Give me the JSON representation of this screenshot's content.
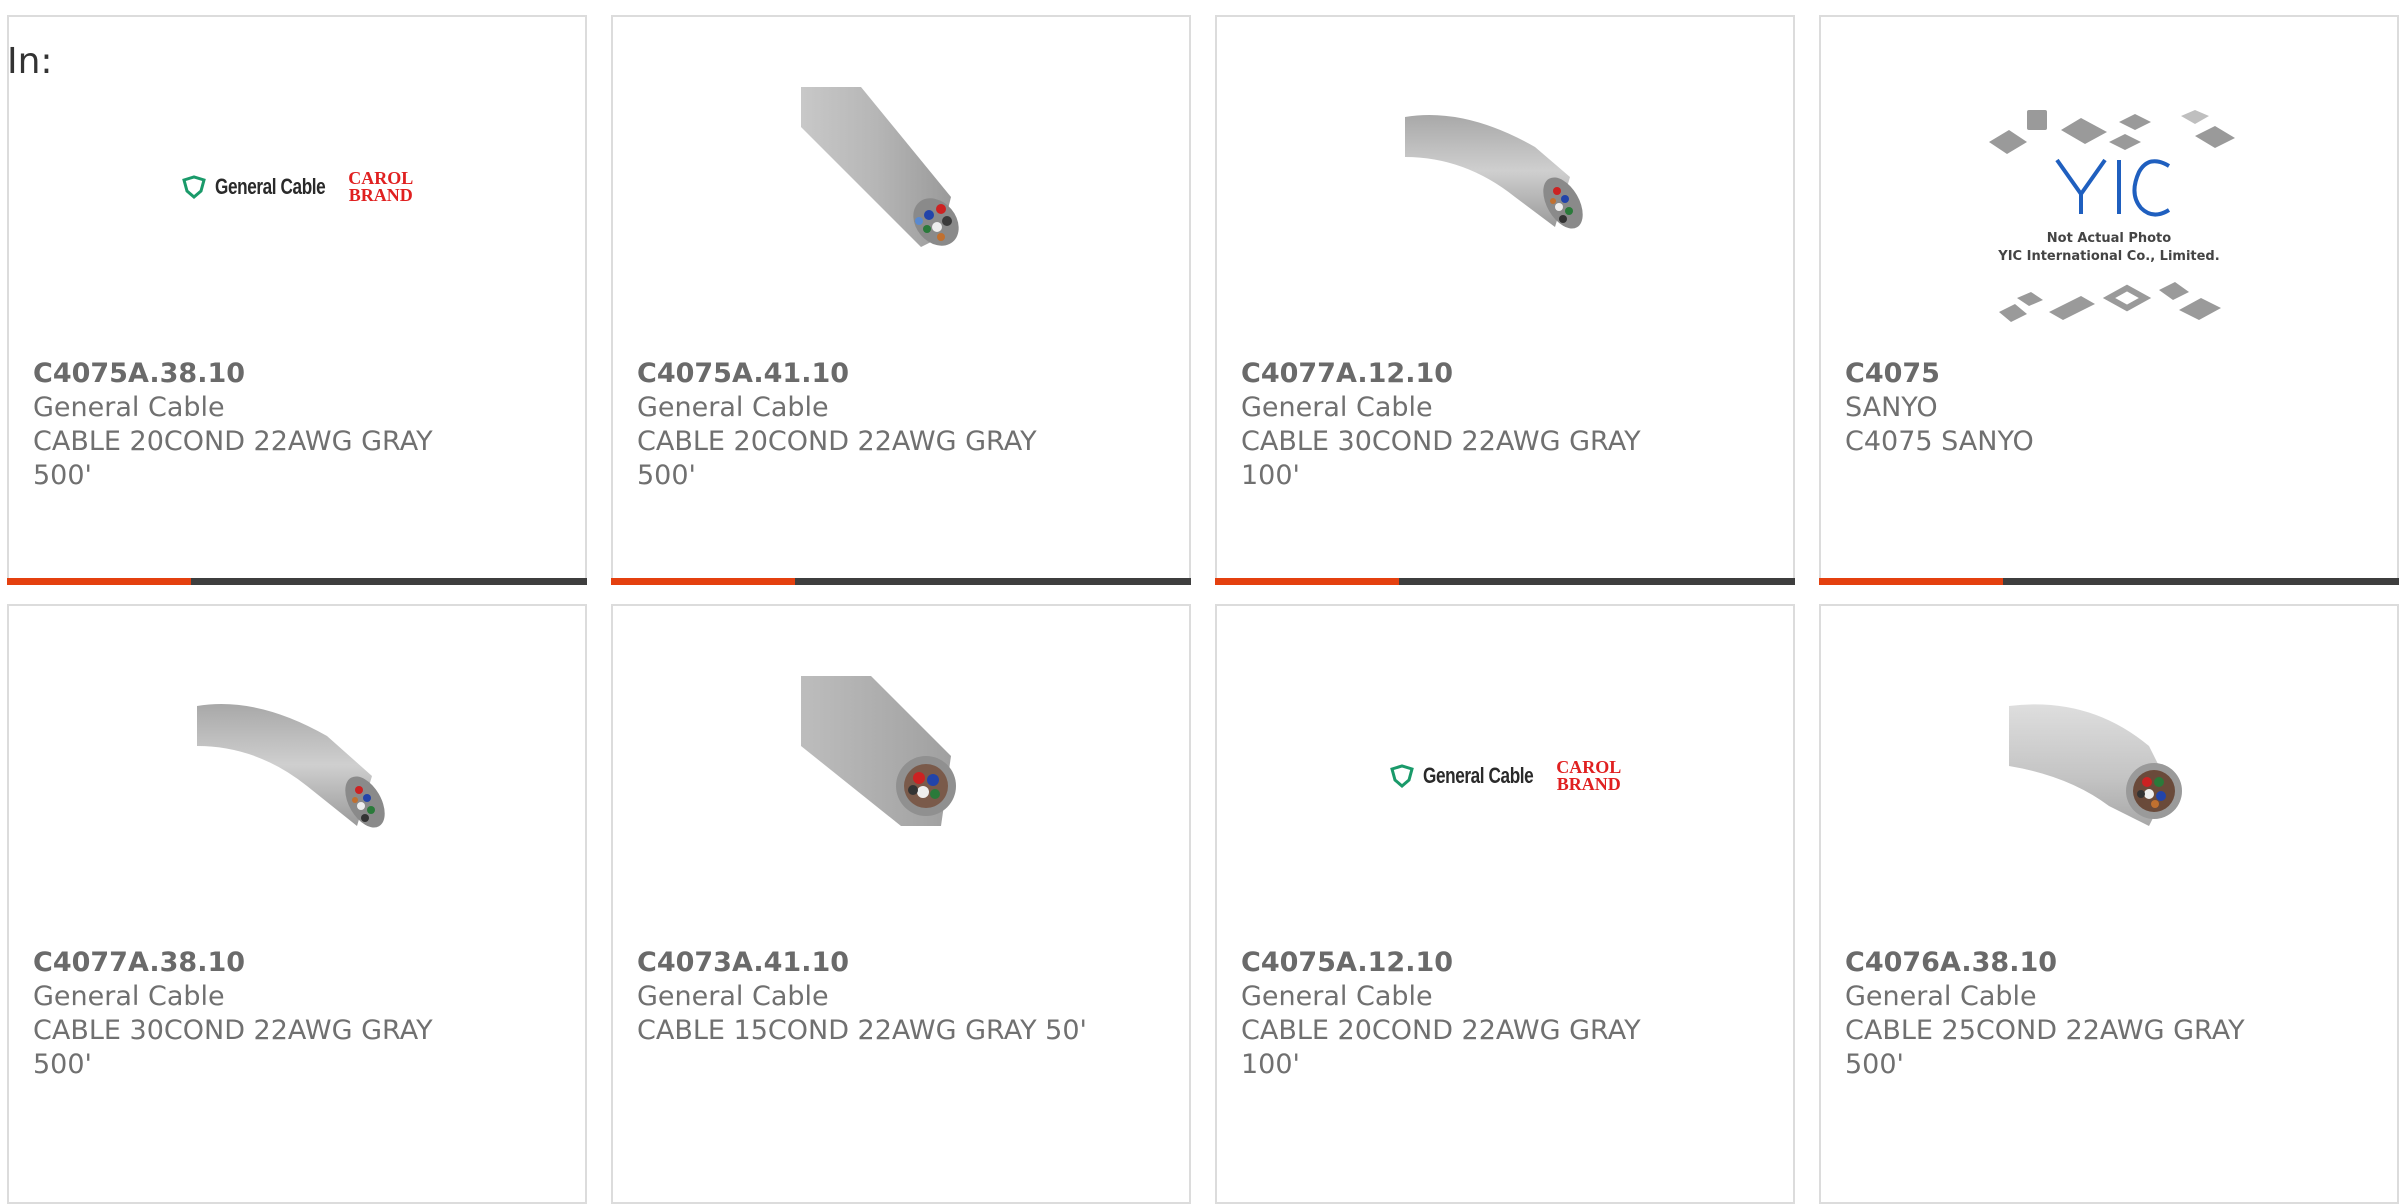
{
  "filter": {
    "label": "In:"
  },
  "products": [
    {
      "part_number": "C4075A.38.10",
      "manufacturer": "General Cable",
      "description": "CABLE 20COND 22AWG GRAY 500'",
      "image": "general-cable-carol-logo"
    },
    {
      "part_number": "C4075A.41.10",
      "manufacturer": "General Cable",
      "description": "CABLE 20COND 22AWG GRAY 500'",
      "image": "gray-cable-photo"
    },
    {
      "part_number": "C4077A.12.10",
      "manufacturer": "General Cable",
      "description": "CABLE 30COND 22AWG GRAY 100'",
      "image": "gray-cable-photo"
    },
    {
      "part_number": "C4075",
      "manufacturer": "SANYO",
      "description": "C4075 SANYO",
      "image": "yic-placeholder",
      "image_text": [
        "Not Actual Photo",
        "YIC International Co., Limited."
      ]
    },
    {
      "part_number": "C4077A.38.10",
      "manufacturer": "General Cable",
      "description": "CABLE 30COND 22AWG GRAY 500'",
      "image": "gray-cable-photo"
    },
    {
      "part_number": "C4073A.41.10",
      "manufacturer": "General Cable",
      "description": "CABLE 15COND 22AWG GRAY 50'",
      "image": "gray-cable-photo"
    },
    {
      "part_number": "C4075A.12.10",
      "manufacturer": "General Cable",
      "description": "CABLE 20COND 22AWG GRAY 100'",
      "image": "general-cable-carol-logo"
    },
    {
      "part_number": "C4076A.38.10",
      "manufacturer": "General Cable",
      "description": "CABLE 25COND 22AWG GRAY 500'",
      "image": "gray-cable-photo"
    }
  ],
  "logo": {
    "brand": "General Cable",
    "sub_brand_line1": "CAROL",
    "sub_brand_line2": "BRAND"
  },
  "colors": {
    "accent": "#e4400f",
    "bar": "#3e3e3e",
    "text": "#707070",
    "card_border": "#dcdcdc"
  }
}
